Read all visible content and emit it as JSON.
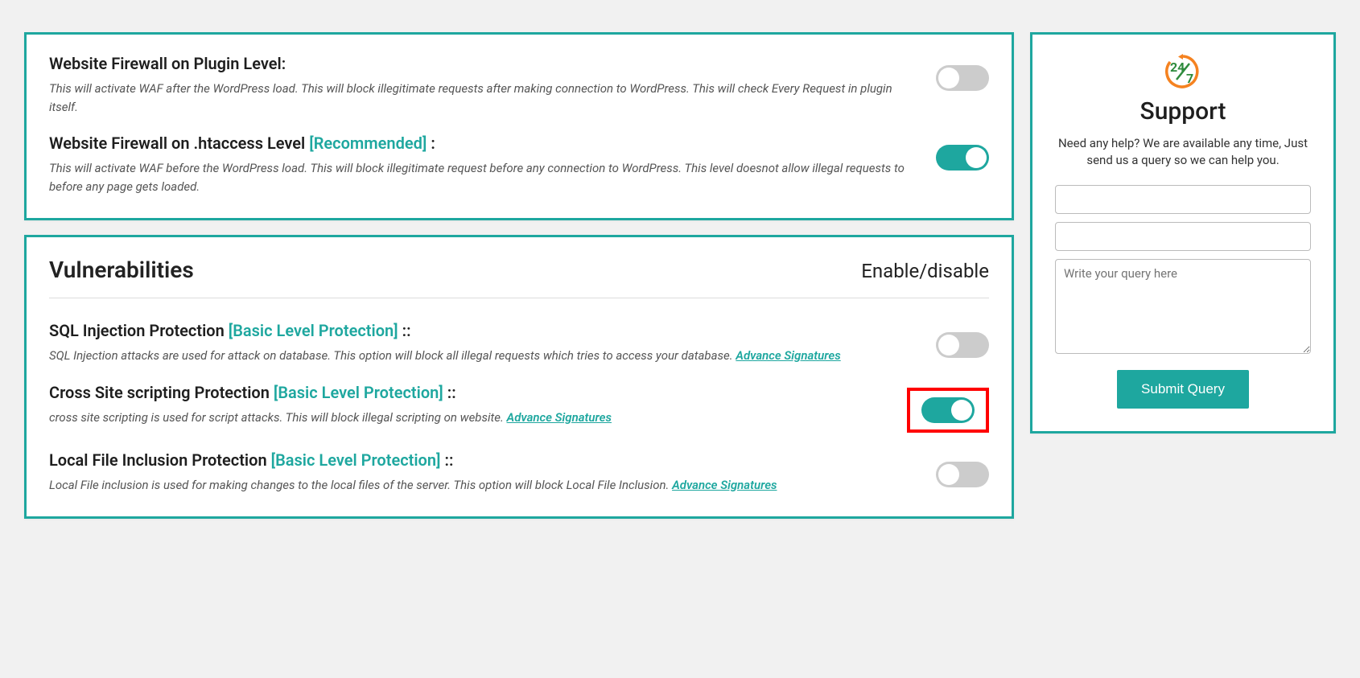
{
  "firewall": {
    "plugin_level": {
      "title_prefix": "Website Firewall on Plugin Level:",
      "desc": "This will activate WAF after the WordPress load. This will block illegitimate requests after making connection to WordPress. This will check Every Request in plugin itself.",
      "enabled": false
    },
    "htaccess_level": {
      "title_prefix": "Website Firewall on .htaccess Level ",
      "tag": "[Recommended]",
      "title_suffix": " :",
      "desc": "This will activate WAF before the WordPress load. This will block illegitimate request before any connection to WordPress. This level doesnot allow illegal requests to before any page gets loaded.",
      "enabled": true
    }
  },
  "vuln_panel": {
    "title": "Vulnerabilities",
    "toggle_label": "Enable/disable",
    "items": [
      {
        "title_prefix": "SQL Injection Protection ",
        "tag": "[Basic Level Protection]",
        "title_suffix": " ::",
        "desc": "SQL Injection attacks are used for attack on database. This option will block all illegal requests which tries to access your database. ",
        "adv_link": "Advance Signatures",
        "enabled": false,
        "highlighted": false
      },
      {
        "title_prefix": "Cross Site scripting Protection ",
        "tag": "[Basic Level Protection]",
        "title_suffix": " ::",
        "desc": "cross site scripting is used for script attacks. This will block illegal scripting on website. ",
        "adv_link": "Advance Signatures",
        "enabled": true,
        "highlighted": true
      },
      {
        "title_prefix": "Local File Inclusion Protection ",
        "tag": "[Basic Level Protection]",
        "title_suffix": " ::",
        "desc": "Local File inclusion is used for making changes to the local files of the server. This option will block Local File Inclusion. ",
        "adv_link": "Advance Signatures",
        "enabled": false,
        "highlighted": false
      }
    ]
  },
  "support": {
    "title": "Support",
    "desc": "Need any help? We are available any time, Just send us a query so we can help you.",
    "query_placeholder": "Write your query here",
    "submit_label": "Submit Query"
  }
}
